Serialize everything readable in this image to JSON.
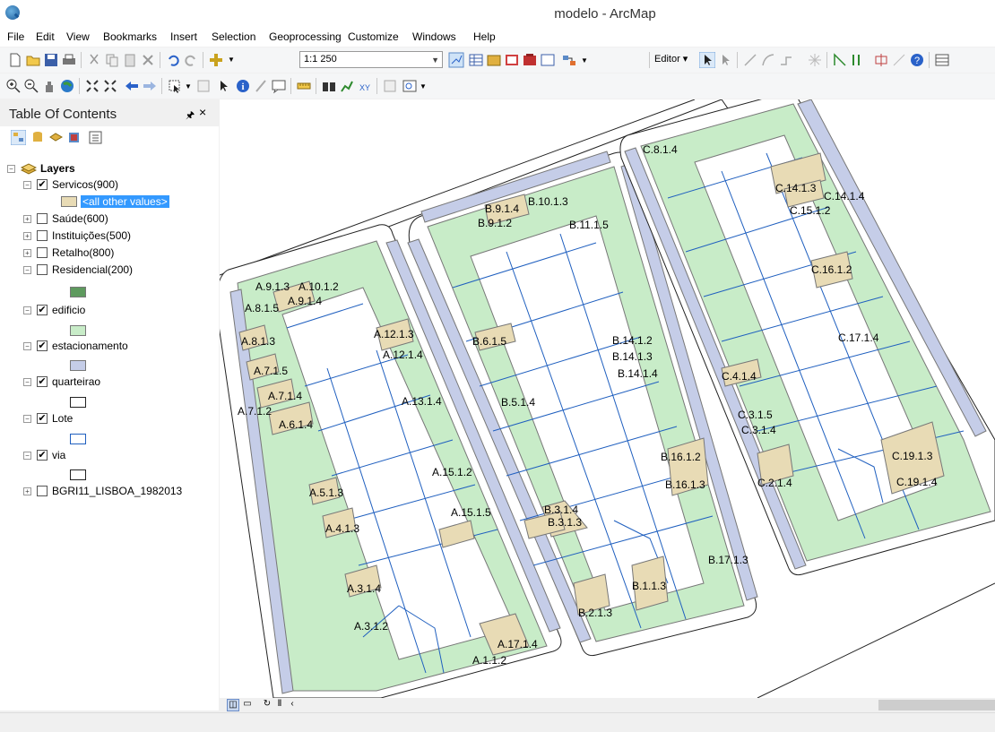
{
  "window": {
    "title": "modelo - ArcMap"
  },
  "menu": [
    "File",
    "Edit",
    "View",
    "Bookmarks",
    "Insert",
    "Selection",
    "Geoprocessing",
    "Customize",
    "Windows",
    "Help"
  ],
  "toolbar": {
    "scale": "1:1 250",
    "editor_label": "Editor"
  },
  "toc": {
    "title": "Table Of Contents",
    "root": "Layers",
    "layers": [
      {
        "name": "Servicos(900)",
        "checked": true,
        "expanded": true,
        "sub_label": "<all other values>",
        "swatch": "#e8dbb5"
      },
      {
        "name": "Saúde(600)",
        "checked": false,
        "expanded": false
      },
      {
        "name": "Instituições(500)",
        "checked": false,
        "expanded": false
      },
      {
        "name": "Retalho(800)",
        "checked": false,
        "expanded": false
      },
      {
        "name": "Residencial(200)",
        "checked": false,
        "expanded": true,
        "swatch": "#5e9a5e"
      },
      {
        "name": "edificio",
        "checked": true,
        "expanded": true,
        "swatch": "#c8ecc8"
      },
      {
        "name": "estacionamento",
        "checked": true,
        "expanded": true,
        "swatch": "#c5cde8"
      },
      {
        "name": "quarteirao",
        "checked": true,
        "expanded": true,
        "swatch": "#ffffff"
      },
      {
        "name": "Lote",
        "checked": true,
        "expanded": true,
        "swatch": "#ffffff"
      },
      {
        "name": "via",
        "checked": true,
        "expanded": true,
        "swatch": "#ffffff"
      },
      {
        "name": "BGRI11_LISBOA_1982013",
        "checked": false,
        "expanded": false
      }
    ]
  },
  "map": {
    "colors": {
      "building": "#c8ecc8",
      "service": "#e8dbb5",
      "parking": "#c5cde8",
      "lot_line": "#1f5fbf"
    },
    "labels": {
      "block_a": [
        "A.9.1.3",
        "A.10.1.2",
        "A.8.1.5",
        "A.9.1.4",
        "A.8.1.3",
        "A.12.1.3",
        "A.12.1.4",
        "A.7.1.5",
        "A.7.1.4",
        "A.7.1.2",
        "A.6.1.4",
        "A.13.1.4",
        "A.15.1.2",
        "A.5.1.3",
        "A.15.1.5",
        "A.4.1.3",
        "A.3.1.4",
        "A.3.1.2",
        "A.17.1.4",
        "A.1.1.2"
      ],
      "block_b": [
        "B.9.1.4",
        "B.10.1.3",
        "B.9.1.2",
        "B.11.1.5",
        "B.6.1.5",
        "B.14.1.2",
        "B.14.1.3",
        "B.14.1.4",
        "B.5.1.4",
        "B.16.1.2",
        "B.16.1.3",
        "B.3.1.4",
        "B.3.1.3",
        "B.17.1.3",
        "B.1.1.3",
        "B.2.1.3"
      ],
      "block_c": [
        "C.8.1.4",
        "C.14.1.3",
        "C.14.1.4",
        "C.15.1.2",
        "C.16.1.2",
        "C.17.1.4",
        "C.4.1.4",
        "C.3.1.5",
        "C.3.1.4",
        "C.19.1.3",
        "C.2.1.4",
        "C.19.1.4"
      ]
    }
  }
}
